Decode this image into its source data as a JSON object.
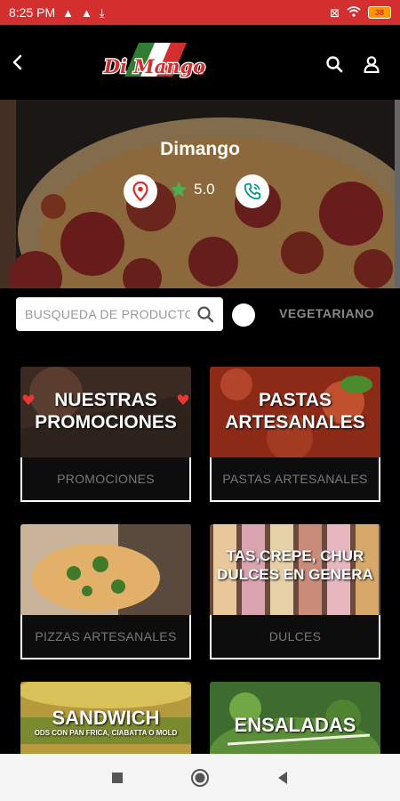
{
  "status_bar": {
    "time": "8:25 PM",
    "battery": "38"
  },
  "header": {
    "logo_text": "Di Mango",
    "icons": [
      "back-arrow-icon",
      "search-icon",
      "user-icon"
    ]
  },
  "restaurant": {
    "name": "Dimango",
    "rating": "5.0",
    "icons": [
      "map-pin-icon",
      "star-icon",
      "phone-icon"
    ],
    "accent": "#d32f2f",
    "star_color": "#4caf50",
    "phone_color": "#009688"
  },
  "search": {
    "placeholder": "BUSQUEDA DE PRODUCTOS",
    "vegetarian_label": "VEGETARIANO"
  },
  "categories": [
    {
      "image_text_1": "NUESTRAS",
      "image_text_2": "PROMOCIONES",
      "label": "PROMOCIONES"
    },
    {
      "image_text_1": "PASTAS",
      "image_text_2": "ARTESANALES",
      "label": "PASTAS ARTESANALES"
    },
    {
      "label": "PIZZAS ARTESANALES"
    },
    {
      "image_text_1": "TAS,CREPE, CHUR",
      "image_text_2": "DULCES EN GENERA",
      "label": "DULCES"
    },
    {
      "image_text_1": "SANDWICH",
      "image_text_2": "ODS CON PAN FRICA, CIABATTA O MOLD"
    },
    {
      "image_text_1": "ENSALADAS"
    }
  ]
}
